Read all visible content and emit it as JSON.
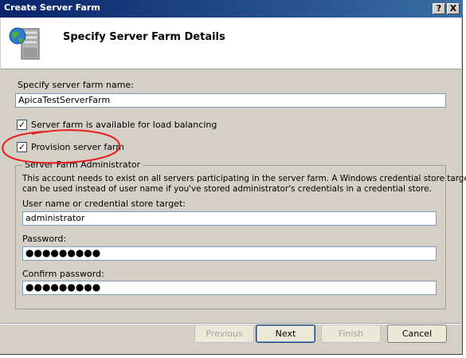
{
  "window": {
    "title": "Create Server Farm",
    "help_glyph": "?",
    "close_glyph": "X"
  },
  "header": {
    "title": "Specify Server Farm Details",
    "icon": "server-globe-icon"
  },
  "farm_name": {
    "label": "Specify server farm name:",
    "value": "ApicaTestServerFarm"
  },
  "options": {
    "load_balancing": {
      "label": "Server farm is available for load balancing",
      "checked": true,
      "glyph": "✓"
    },
    "provision": {
      "label": "Provision server farm",
      "checked": true,
      "glyph": "✓"
    }
  },
  "admin_group": {
    "legend": "Server Farm Administrator",
    "description_line1": "This account needs to exist on all servers participating in the server farm. A Windows credential store target",
    "description_line2": "can be used instead of user name if you've stored administrator's credentials in a credential store.",
    "user_label": "User name or credential store target:",
    "user_value": "administrator",
    "password_label": "Password:",
    "password_value": "●●●●●●●●●",
    "confirm_label": "Confirm password:",
    "confirm_value": "●●●●●●●●●"
  },
  "buttons": {
    "previous": "Previous",
    "next": "Next",
    "finish": "Finish",
    "cancel": "Cancel"
  },
  "colors": {
    "annotation": "#e8201a",
    "titlebar": "#0a246a",
    "dialog": "#d4d0c8"
  }
}
